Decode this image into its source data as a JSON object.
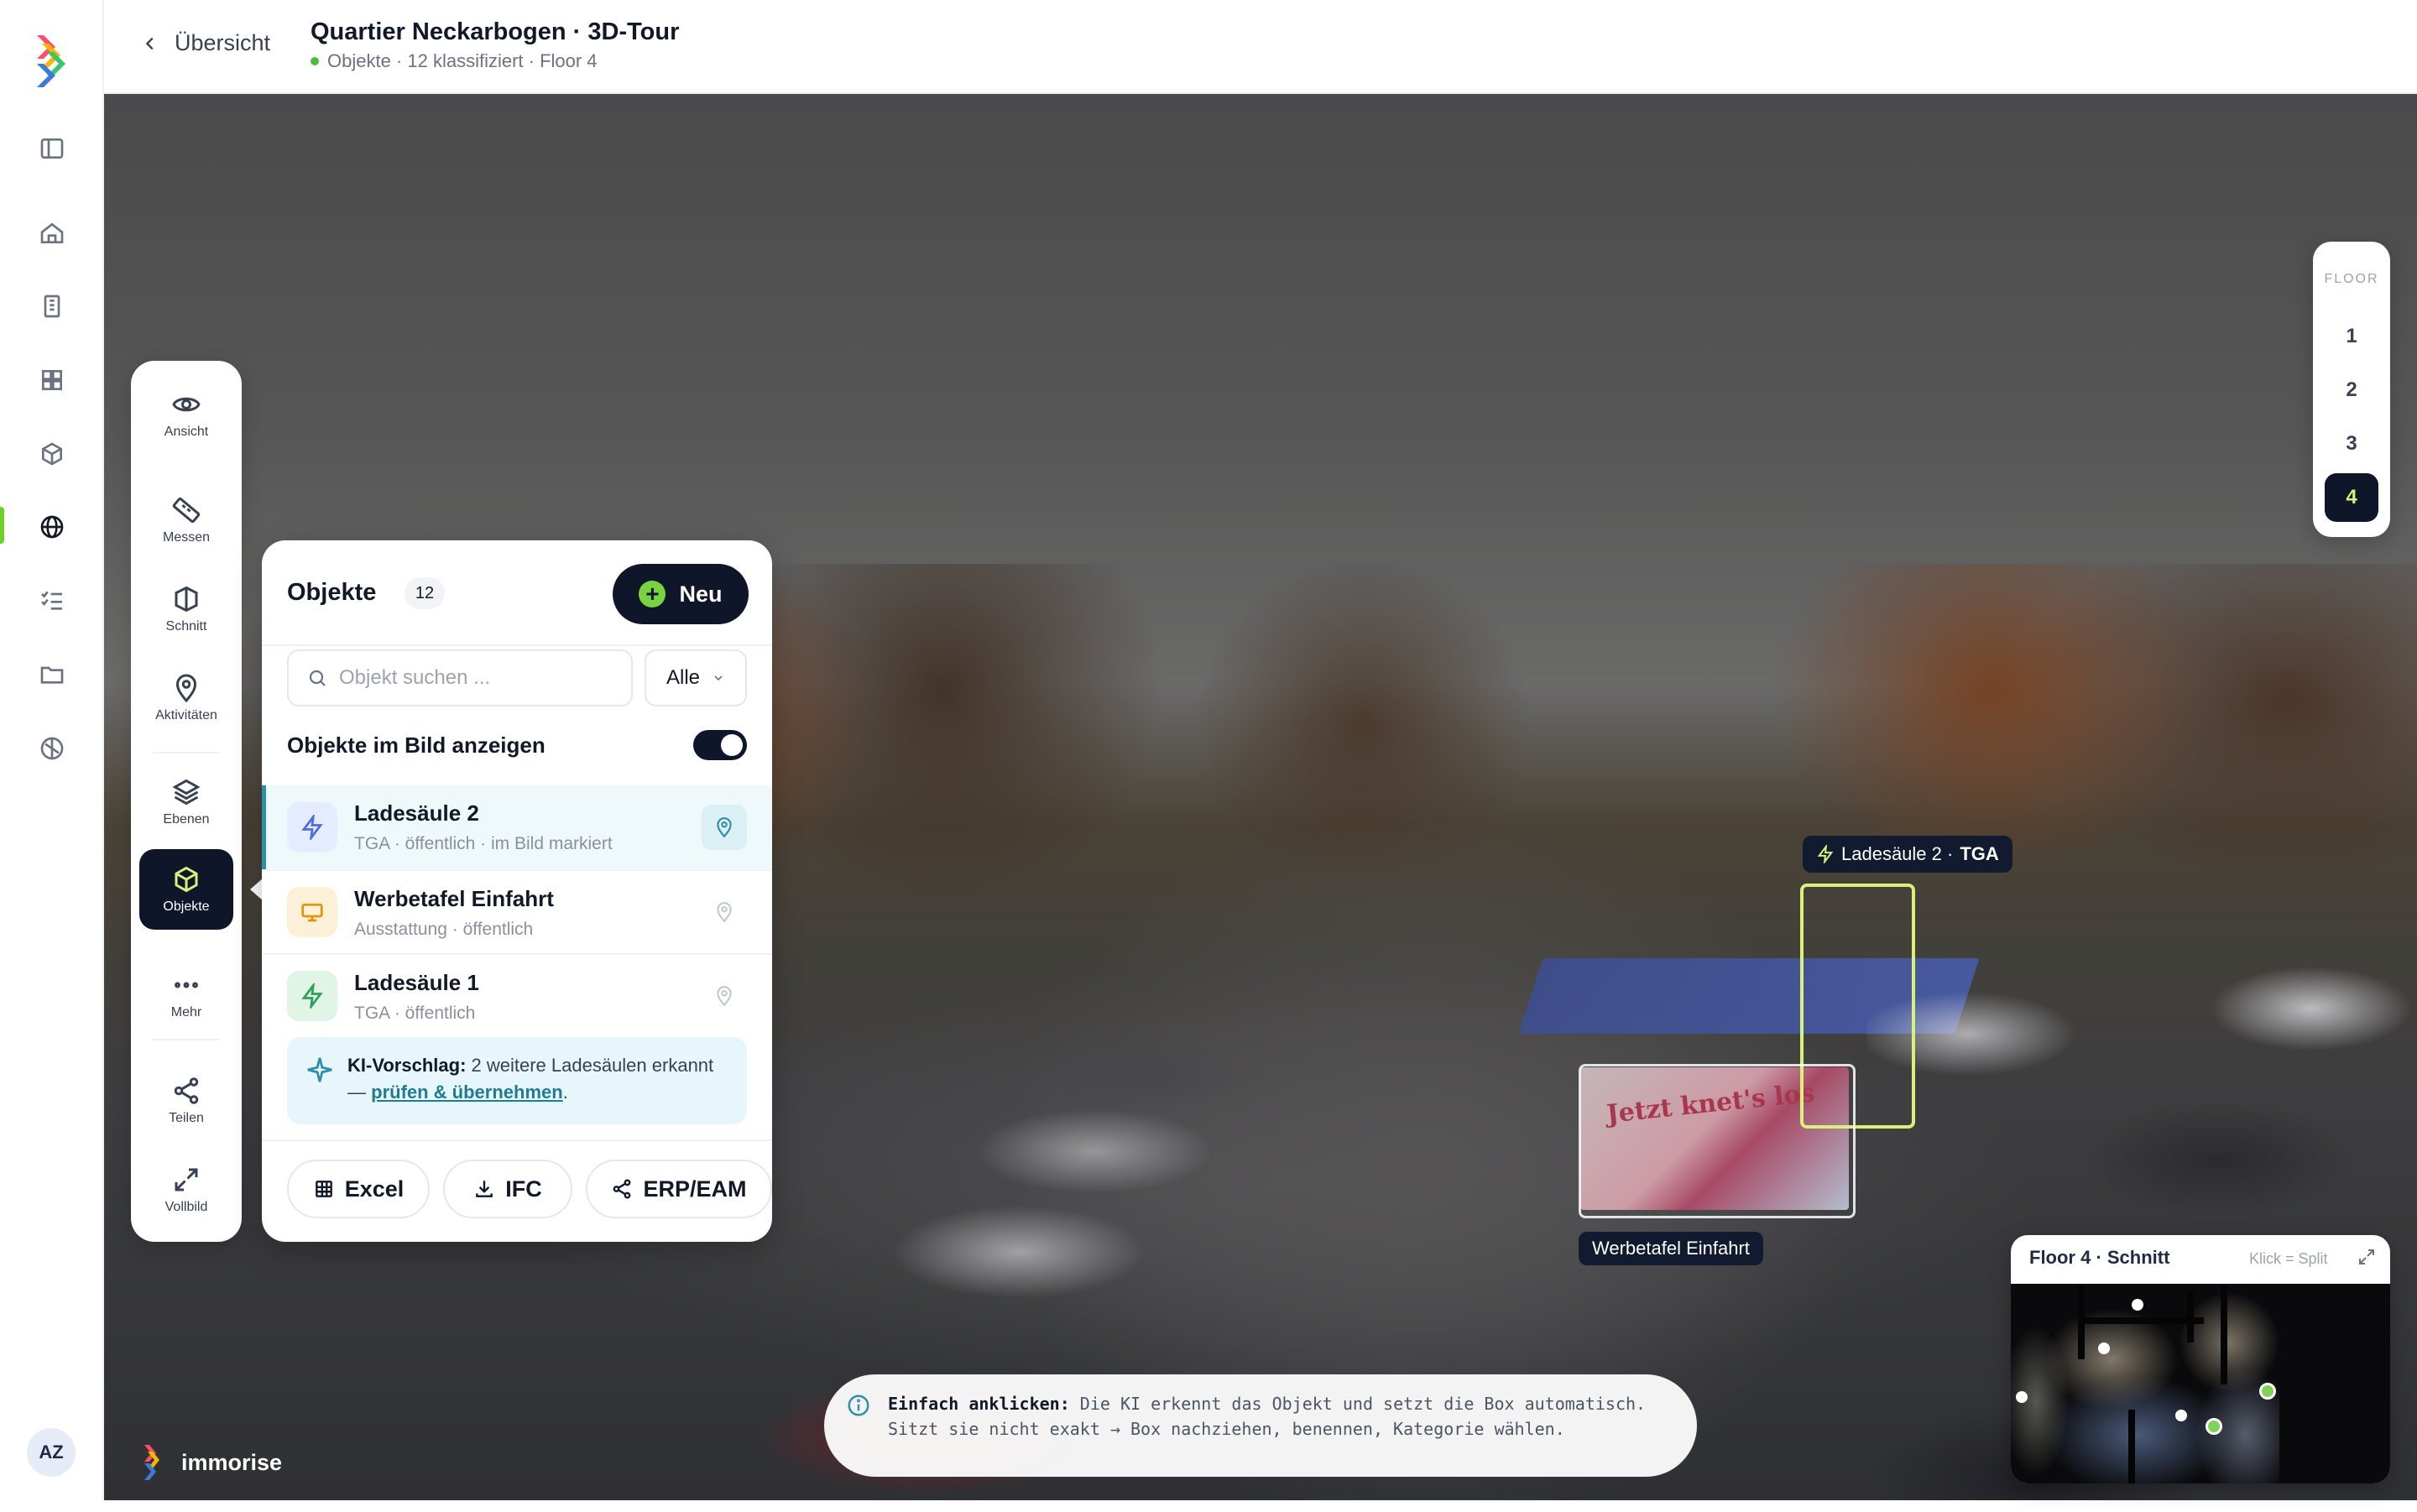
{
  "app": {
    "brand_name": "immorise",
    "accent_color": "#d9f07a",
    "active_nav": "tour"
  },
  "user": {
    "initials": "AZ"
  },
  "nav": {
    "items": [
      {
        "id": "toggle-sidebar",
        "icon": "sidebar-icon"
      },
      {
        "id": "home",
        "icon": "home-icon"
      },
      {
        "id": "buildings",
        "icon": "building-icon"
      },
      {
        "id": "dashboard",
        "icon": "grid-icon"
      },
      {
        "id": "models",
        "icon": "cube-icon"
      },
      {
        "id": "tour",
        "icon": "globe-icon"
      },
      {
        "id": "tasks",
        "icon": "checklist-icon"
      },
      {
        "id": "files",
        "icon": "folder-icon"
      },
      {
        "id": "network",
        "icon": "network-icon"
      }
    ]
  },
  "header": {
    "back_label": "Übersicht",
    "title": "Quartier Neckarbogen · 3D-Tour",
    "subtitle": "Objekte · 12 klassifiziert · Floor 4"
  },
  "tools": [
    {
      "label": "Ansicht",
      "icon": "eye-icon",
      "active": false
    },
    {
      "label": "Messen",
      "icon": "ruler-icon",
      "active": false
    },
    {
      "label": "Schnitt",
      "icon": "section-icon",
      "active": false
    },
    {
      "label": "Aktivitäten",
      "icon": "pin-icon",
      "active": false
    },
    {
      "label": "Ebenen",
      "icon": "layers-icon",
      "active": false
    },
    {
      "label": "Objekte",
      "icon": "cube-icon",
      "active": true
    },
    {
      "label": "Mehr",
      "icon": "more-icon",
      "active": false
    },
    {
      "label": "Teilen",
      "icon": "share-icon",
      "active": false
    },
    {
      "label": "Vollbild",
      "icon": "fullscreen-icon",
      "active": false
    }
  ],
  "panel": {
    "title": "Objekte",
    "count": "12",
    "new_label": "Neu",
    "search_placeholder": "Objekt suchen ...",
    "filter_value": "Alle",
    "toggle_label": "Objekte im Bild anzeigen",
    "toggle_on": true,
    "items": [
      {
        "name": "Ladesäule 2",
        "meta": "TGA · öffentlich · im Bild markiert",
        "icon": "bolt-icon",
        "selected": true
      },
      {
        "name": "Werbetafel Einfahrt",
        "meta": "Ausstattung · öffentlich",
        "icon": "billboard-icon",
        "selected": false
      },
      {
        "name": "Ladesäule 1",
        "meta": "TGA · öffentlich",
        "icon": "bolt-icon",
        "selected": false
      }
    ],
    "ai_hint": {
      "lead": "KI-Vorschlag:",
      "text": " 2 weitere Ladesäulen erkannt — ",
      "link": "prüfen & übernehmen",
      "tail": "."
    },
    "exports": {
      "excel": "Excel",
      "ifc": "IFC",
      "erp": "ERP/EAM"
    }
  },
  "scene": {
    "tag_tga_name": "Ladesäule 2 · ",
    "tag_tga_cat": "TGA",
    "tag_werb": "Werbetafel Einfahrt",
    "billboard_text": "Jetzt knet's los"
  },
  "floors": {
    "label": "FLOOR",
    "options": [
      "1",
      "2",
      "3",
      "4"
    ],
    "selected": "4"
  },
  "minimap": {
    "title": "Floor 4 · Schnitt",
    "hint": "Klick = Split"
  },
  "bottom_hint": {
    "lead": "Einfach anklicken:",
    "text": " Die KI erkennt das Objekt und setzt die Box automatisch. Sitzt sie nicht exakt → Box nachziehen, benennen, Kategorie wählen."
  }
}
